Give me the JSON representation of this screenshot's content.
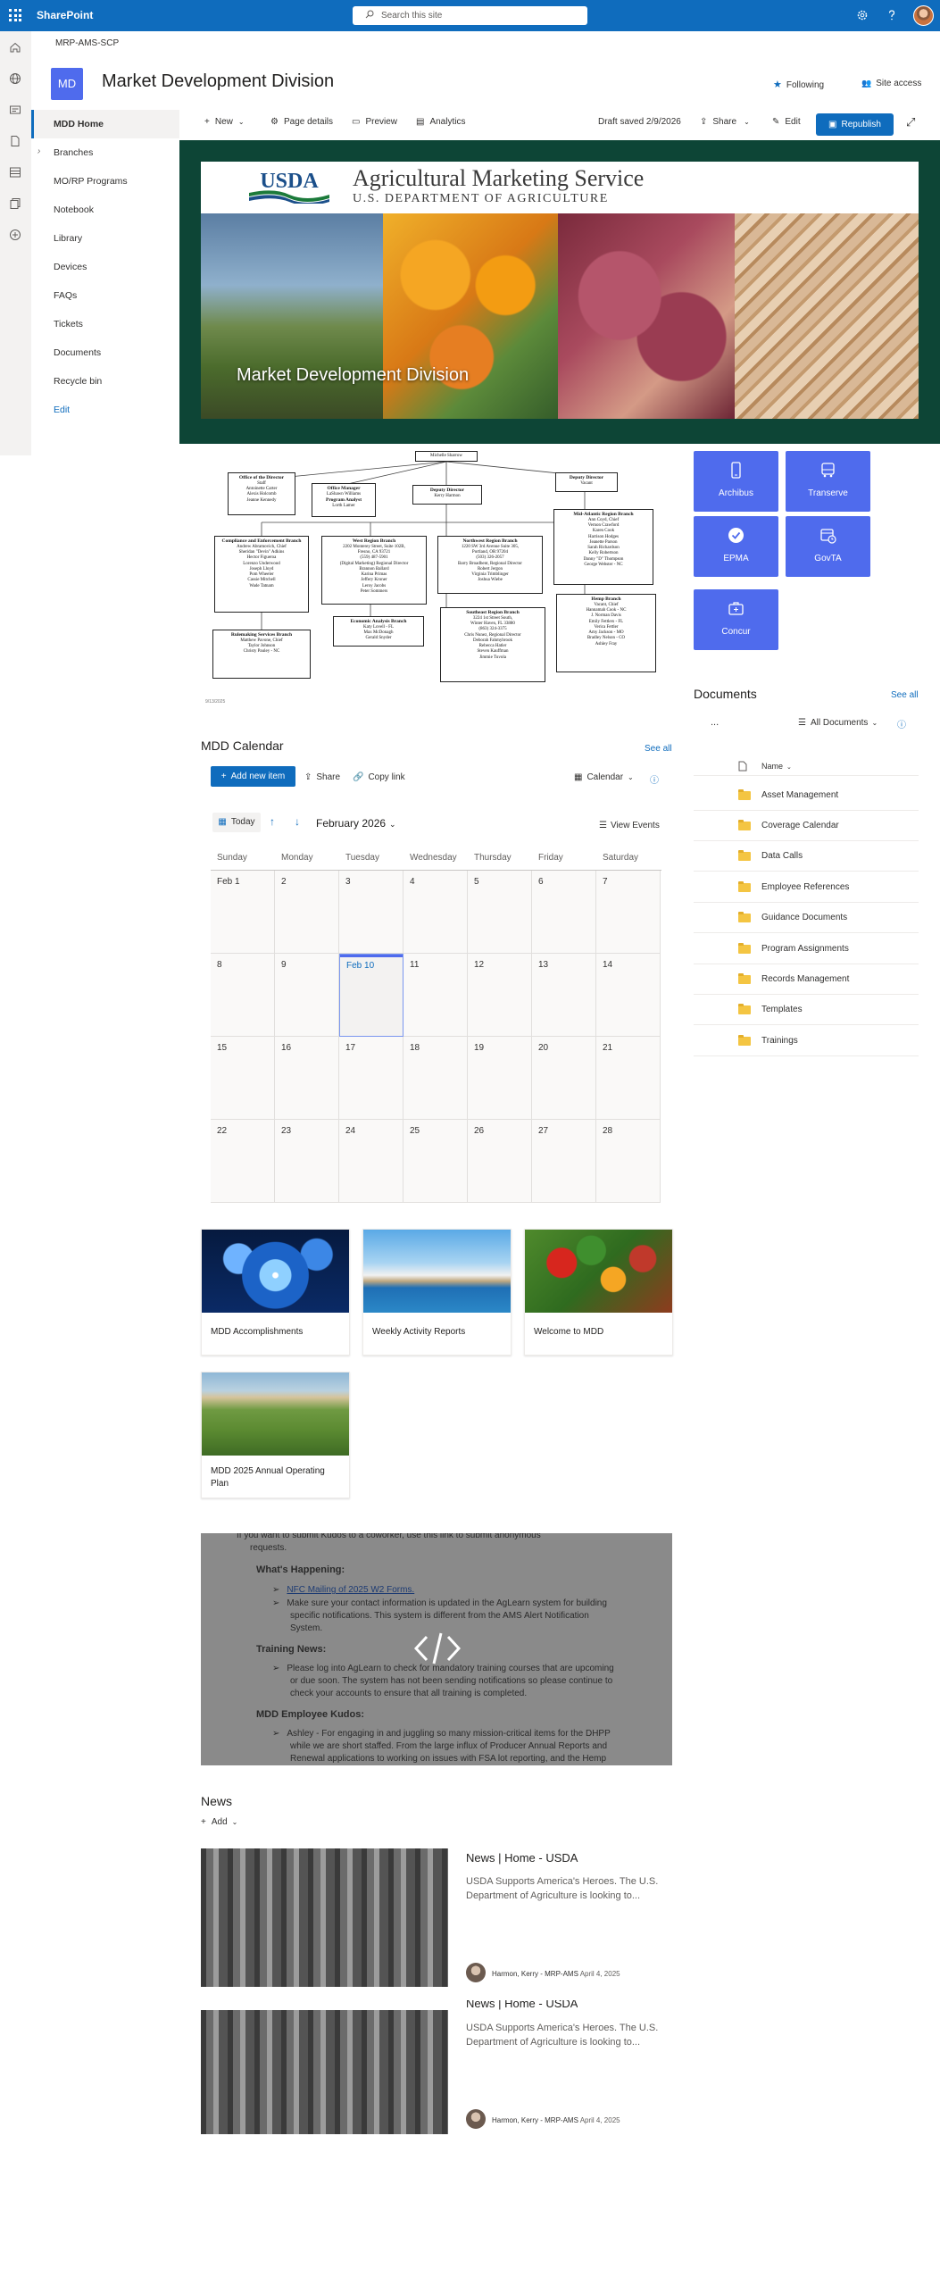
{
  "suite": {
    "app_name": "SharePoint",
    "search_placeholder": "Search this site",
    "icons": [
      "waffle-icon",
      "gear-icon",
      "help-icon",
      "avatar"
    ]
  },
  "site": {
    "breadcrumb": "MRP-AMS-SCP",
    "logo_text": "MD",
    "title": "Market Development Division",
    "following": "Following",
    "site_access": "Site access"
  },
  "nav": {
    "items": [
      "MDD Home",
      "Branches",
      "MO/RP Programs",
      "Notebook",
      "Library",
      "Devices",
      "FAQs",
      "Tickets",
      "Documents",
      "Recycle bin"
    ],
    "edit": "Edit",
    "active": "MDD Home"
  },
  "commandbar": {
    "new": "New",
    "page_details": "Page details",
    "preview": "Preview",
    "analytics": "Analytics",
    "draft": "Draft saved 2/9/2026",
    "share": "Share",
    "edit": "Edit",
    "republish": "Republish"
  },
  "hero": {
    "usda": "USDA",
    "ams_title": "Agricultural Marketing Service",
    "ams_sub": "U.S. DEPARTMENT OF AGRICULTURE",
    "title": "Market Development Division"
  },
  "org_chart": {
    "top": "Michelle Sharrow",
    "boxes": [
      {
        "title": "Office of the Director",
        "lines": [
          "Staff",
          "Antoinette Carter",
          "Alexis Holcomb",
          "Jeanne Kennedy"
        ]
      },
      {
        "title": "Office Manager",
        "lines": [
          "LaShawn Williams",
          "Program Analyst",
          "Lorth Lamer"
        ]
      },
      {
        "title": "Deputy Director",
        "lines": [
          "Kerry Harmon"
        ]
      },
      {
        "title": "Deputy Director",
        "lines": [
          "Vacant"
        ]
      },
      {
        "title": "Compliance and Enforcement Branch",
        "lines": [
          "Andrew Abramovich, Chief",
          "Sheridan \"Devin\" Adkins",
          "Hector Figueroa",
          "Lorenzo Underwood",
          "Joseph Lloyd",
          "Pom Wheeler",
          "Cassie Mitchell",
          "Wade Tatnam"
        ]
      },
      {
        "title": "West Region Branch",
        "lines": [
          "2202 Monterey Street, Suite 102B,",
          "Fresno, CA 93721",
          "(559) 487-5901",
          "(Digital Marketing) Regional Director",
          "Brannon Ballard",
          "Karina Primas",
          "Jeffery Kroner",
          "Leroy Jacobs",
          "Peter Sommers"
        ]
      },
      {
        "title": "Northwest Region Branch",
        "lines": [
          "1220 SW 3rd Avenue Suite 305,",
          "Portland, OR 97204",
          "(503) 326-2057",
          "Barry Broadbent, Regional Director",
          "Robert Jergon",
          "Virginia Trimblinger",
          "Joshua Wiebe"
        ]
      },
      {
        "title": "Mid-Atlantic Region Branch",
        "lines": [
          "Ann Coyd, Chief",
          "Vernon Crawford",
          "Karen Cook",
          "Harrison Hodges",
          "Jeanette Parson",
          "Sarah Richardson",
          "Kelly Robertson",
          "Danny \"D\" Thompson",
          "George Webster - NC"
        ]
      },
      {
        "title": "Economic Analysis Branch",
        "lines": [
          "Katy Lovell - FL",
          "Max McDonagh",
          "Gerald Snyder"
        ]
      },
      {
        "title": "Southeast Region Branch",
        "lines": [
          "3224 1st Street South,",
          "Winter Haven, FL 33880",
          "(863) 324-3375",
          "Chris Nunez, Regional Director",
          "Deborah Fahmybrook",
          "Rebecca Hatler",
          "Steven Kauffman",
          "Jimmie Tuvola"
        ]
      },
      {
        "title": "Rulemaking Services Branch",
        "lines": [
          "Matthew Pavone, Chief",
          "Taylor Johnson",
          "Christy Pauley - NC"
        ]
      },
      {
        "title": "Hemp Branch",
        "lines": [
          "Vacant, Chief",
          "Hannamah Cook - NC",
          "J. Norman Davis",
          "Emily Fettlers - FL",
          "Verica Fettler",
          "Amy Jackson - MO",
          "Bradley Nelson - CO",
          "Ashley Fray"
        ]
      }
    ],
    "date": "9/13/2025"
  },
  "quick_links": [
    {
      "label": "Archibus",
      "icon": "phone-icon"
    },
    {
      "label": "Transerve",
      "icon": "bus-icon"
    },
    {
      "label": "EPMA",
      "icon": "check-circle-icon"
    },
    {
      "label": "GovTA",
      "icon": "clock-calendar-icon"
    },
    {
      "label": "Concur",
      "icon": "suitcase-icon"
    }
  ],
  "documents": {
    "title": "Documents",
    "see_all": "See all",
    "more": "...",
    "view": "All Documents",
    "name_col": "Name",
    "folders": [
      "Asset Management",
      "Coverage Calendar",
      "Data Calls",
      "Employee References",
      "Guidance Documents",
      "Program Assignments",
      "Records Management",
      "Templates",
      "Trainings"
    ]
  },
  "calendar": {
    "title": "MDD Calendar",
    "see_all": "See all",
    "add_new": "Add new item",
    "share": "Share",
    "copy_link": "Copy link",
    "view": "Calendar",
    "today": "Today",
    "month": "February 2026",
    "view_events": "View Events",
    "days": [
      "Sunday",
      "Monday",
      "Tuesday",
      "Wednesday",
      "Thursday",
      "Friday",
      "Saturday"
    ],
    "weeks": [
      [
        "Feb 1",
        "2",
        "3",
        "4",
        "5",
        "6",
        "7"
      ],
      [
        "8",
        "9",
        "Feb 10",
        "11",
        "12",
        "13",
        "14"
      ],
      [
        "15",
        "16",
        "17",
        "18",
        "19",
        "20",
        "21"
      ],
      [
        "22",
        "23",
        "24",
        "25",
        "26",
        "27",
        "28"
      ]
    ],
    "today_cell": "Feb 10"
  },
  "cards": [
    "MDD Accomplishments",
    "Weekly Activity Reports",
    "Welcome to MDD",
    "MDD 2025 Annual Operating Plan"
  ],
  "embed": {
    "l1": "If you want to submit Kudos to a coworker, use this link to submit anonymous",
    "l2": "requests.",
    "h1": "What's Happening:",
    "b1": "NFC Mailing of 2025 W2 Forms.",
    "b2a": "Make sure your contact information is updated in the AgLearn system for building",
    "b2b": "specific notifications. This system is different from the AMS Alert Notification",
    "b2c": "System.",
    "h2": "Training News:",
    "b3a": "Please log into AgLearn to check for mandatory training courses that are upcoming",
    "b3b": "or due soon. The system has not been sending notifications so please continue to",
    "b3c": "check your accounts to ensure that all training is completed.",
    "h3": "MDD Employee Kudos:",
    "b4a": "Ashley - For engaging in and juggling so many mission-critical items for the DHPP",
    "b4b": "while we are short staffed. From the large influx of Producer Annual Reports and",
    "b4c": "Renewal applications to working on issues with FSA lot reporting, and the Hemp"
  },
  "news": {
    "title": "News",
    "add": "Add",
    "items": [
      {
        "headline": "News | Home - USDA",
        "desc": "USDA Supports America's Heroes. The U.S. Department of Agriculture is looking to...",
        "author": "Harmon, Kerry - MRP-AMS",
        "date": "April 4, 2025"
      },
      {
        "headline": "News | Home - USDA",
        "desc": "USDA Supports America's Heroes. The U.S. Department of Agriculture is looking to...",
        "author": "Harmon, Kerry - MRP-AMS",
        "date": "April 4, 2025"
      }
    ]
  },
  "colors": {
    "suite_blue": "#0f6cbd",
    "accent": "#4f6bed",
    "hero_green": "#0d4536",
    "folder": "#f4c542"
  }
}
